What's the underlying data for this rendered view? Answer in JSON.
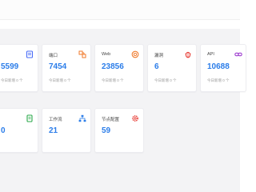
{
  "colors": {
    "value_blue": "#2b7de9",
    "icon_blue": "#4a6cf7",
    "icon_orange": "#f07a2b",
    "icon_red": "#e8413a",
    "icon_green": "#29a84a",
    "icon_purple": "#a040d0"
  },
  "cards_row1": [
    {
      "label": "",
      "value": "5599",
      "sub": "今日新增 0 个",
      "icon": "document-icon"
    },
    {
      "label": "端口",
      "value": "7454",
      "sub": "今日新增 0 个",
      "icon": "port-icon"
    },
    {
      "label": "Web",
      "value": "23856",
      "sub": "今日新增 0 个",
      "icon": "globe-icon"
    },
    {
      "label": "漏洞",
      "value": "6",
      "sub": "今日新增 0 个",
      "icon": "bug-icon"
    },
    {
      "label": "API",
      "value": "10688",
      "sub": "今日新增 0 个",
      "icon": "link-icon"
    }
  ],
  "cards_row2": [
    {
      "label": "",
      "value": "0",
      "icon": "scroll-icon"
    },
    {
      "label": "工作流",
      "value": "21",
      "icon": "workflow-icon"
    },
    {
      "label": "节点配置",
      "value": "59",
      "icon": "gear-icon"
    }
  ]
}
